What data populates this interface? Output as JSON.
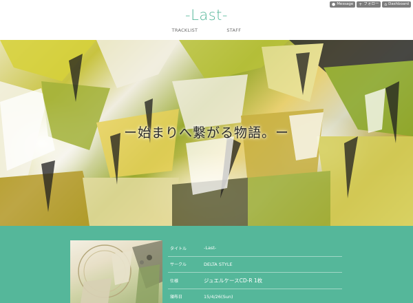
{
  "util": {
    "message": {
      "icon": "message-icon",
      "label": "Message"
    },
    "follow": {
      "icon": "plus-icon",
      "label": "フォロー"
    },
    "dashboard": {
      "icon": "home-icon",
      "label": "Dashboard"
    }
  },
  "header": {
    "title": "-Last-",
    "nav": [
      "TRACKLIST",
      "STAFF"
    ]
  },
  "hero": {
    "caption": "ー始まりへ繋がる物語。ー"
  },
  "specs": [
    {
      "key": "タイトル",
      "value": "-Last-"
    },
    {
      "key": "サークル",
      "value": "DELTA STYLE"
    },
    {
      "key": "仕様",
      "value": "ジュエルケースCD-R 1枚"
    },
    {
      "key": "頒布日",
      "value": "15/4/26(Sun)"
    }
  ],
  "colors": {
    "accent": "#55b79a",
    "util_button": "#7d7d7d"
  }
}
